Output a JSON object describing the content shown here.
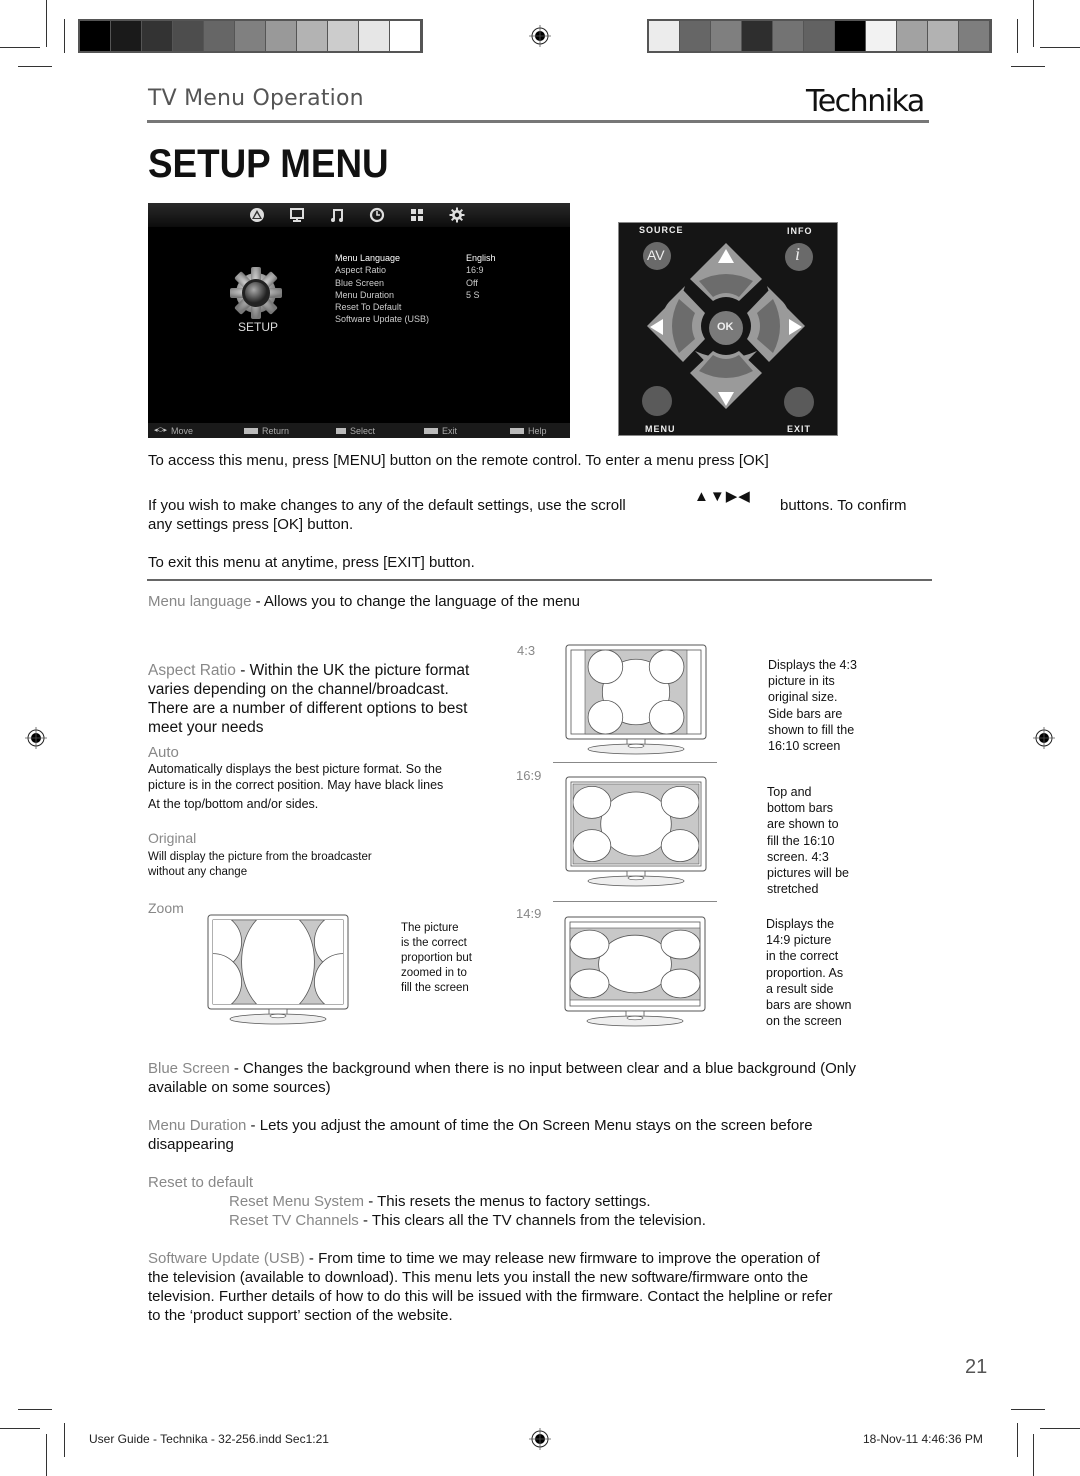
{
  "colors": {
    "text": "#111111",
    "subtle": "#888888",
    "heading_grey": "#555555",
    "osd_bg": "#000000",
    "remote_bg": "#151515",
    "picture_fill": "#c8c8c8"
  },
  "calibration": {
    "left_swatches": [
      "#000000",
      "#1a1a1a",
      "#333333",
      "#4d4d4d",
      "#666666",
      "#808080",
      "#999999",
      "#b3b3b3",
      "#cccccc",
      "#e6e6e6",
      "#ffffff"
    ],
    "right_swatches": [
      "#ececec",
      "#666666",
      "#7f7f7f",
      "#2e2e2e",
      "#737373",
      "#626262",
      "#000000",
      "#f2f2f2",
      "#a2a2a2",
      "#b2b2b2",
      "#7e7e7e"
    ]
  },
  "header": {
    "section": "TV Menu Operation",
    "brand": "Technika",
    "title": "SETUP MENU"
  },
  "osd": {
    "top_icons": [
      "channel-icon",
      "monitor-icon",
      "music-icon",
      "clock-icon",
      "grid-icon",
      "settings-icon"
    ],
    "section_label": "SETUP",
    "items": [
      {
        "label": "Menu Language",
        "value": "English"
      },
      {
        "label": "Aspect Ratio",
        "value": "16:9"
      },
      {
        "label": "Blue Screen",
        "value": "Off"
      },
      {
        "label": "Menu Duration",
        "value": "5 S"
      },
      {
        "label": "Reset To Default",
        "value": ""
      },
      {
        "label": "Software Update (USB)",
        "value": ""
      }
    ],
    "hints": [
      {
        "key": "arrows",
        "label": "Move"
      },
      {
        "key": "MENU",
        "label": "Return"
      },
      {
        "key": "OK",
        "label": "Select"
      },
      {
        "key": "EXIT",
        "label": "Exit"
      },
      {
        "key": "INFO",
        "label": "Help"
      }
    ]
  },
  "remote": {
    "source_label": "SOURCE",
    "info_label": "INFO",
    "av_label": "AV",
    "info_glyph": "i",
    "ok_label": "OK",
    "menu_label": "MENU",
    "exit_label": "EXIT"
  },
  "body": {
    "p1": "To access this menu, press [MENU] button on the remote control. To enter a menu press [OK]",
    "p2a": "If you wish to make changes to any of the default settings, use the scroll",
    "p2_arrows": "▲▼▶◀",
    "p2b": "buttons. To confirm",
    "p2c": "any settings press [OK] button.",
    "p3": "To exit this menu at anytime, press [EXIT] button.",
    "menu_language_term": "Menu language",
    "menu_language_desc": " - Allows you to change the language of the menu",
    "aspect_term": "Aspect Ratio",
    "aspect_desc_1": " - Within the UK the picture format",
    "aspect_desc_2": "varies depending on the channel/broadcast.",
    "aspect_desc_3": "There are a number of different options to best",
    "aspect_desc_4": "meet your needs",
    "auto_term": "Auto",
    "auto_desc_1": "Automatically displays the best picture format. So the",
    "auto_desc_2": "picture is in the correct position. May have black lines",
    "auto_desc_3": "At the top/bottom and/or sides.",
    "original_term": "Original",
    "original_desc_1": "Will display the picture from the broadcaster",
    "original_desc_2": "without any change",
    "zoom_term": "Zoom",
    "zoom_note": [
      "The picture",
      "is the correct",
      "proportion but",
      "zoomed in to",
      "fill the screen"
    ],
    "ratio_43": "4:3",
    "ratio_43_note": [
      "Displays the 4:3",
      "picture in its",
      "original size.",
      "Side bars are",
      "shown to fill the",
      "16:10 screen"
    ],
    "ratio_169": "16:9",
    "ratio_169_note": [
      "Top and",
      "bottom bars",
      "are shown to",
      "fill the 16:10",
      "screen. 4:3",
      "pictures will be",
      "stretched"
    ],
    "ratio_149": "14:9",
    "ratio_149_note": [
      "Displays the",
      "14:9 picture",
      "in the correct",
      "proportion. As",
      "a result side",
      "bars are shown",
      "on the screen"
    ],
    "blue_term": "Blue Screen",
    "blue_desc_1": " - Changes the background when there is no input between clear and a blue background (Only",
    "blue_desc_2": "available on some sources)",
    "duration_term": "Menu Duration",
    "duration_desc_1": " - Lets you adjust the amount of time the On Screen Menu stays on the screen before",
    "duration_desc_2": "disappearing",
    "reset_term": "Reset to default",
    "reset_menu_term": "Reset Menu System",
    "reset_menu_desc": " - This resets the menus to factory settings.",
    "reset_tv_term": "Reset TV Channels",
    "reset_tv_desc": " - This clears all the TV channels from the television.",
    "software_term": "Software Update (USB)",
    "software_desc_1": " - From time to time we may release new firmware to improve the operation of",
    "software_desc_2": "the television (available to download). This menu lets you install the new software/firmware onto the",
    "software_desc_3": "television. Further details of how to do this will be issued with the firmware. Contact the helpline or refer",
    "software_desc_4": "to the ‘product support’ section of the website."
  },
  "footer": {
    "page_number": "21",
    "file_info": "User Guide - Technika - 32-256.indd   Sec1:21",
    "timestamp": "18-Nov-11   4:46:36 PM"
  }
}
